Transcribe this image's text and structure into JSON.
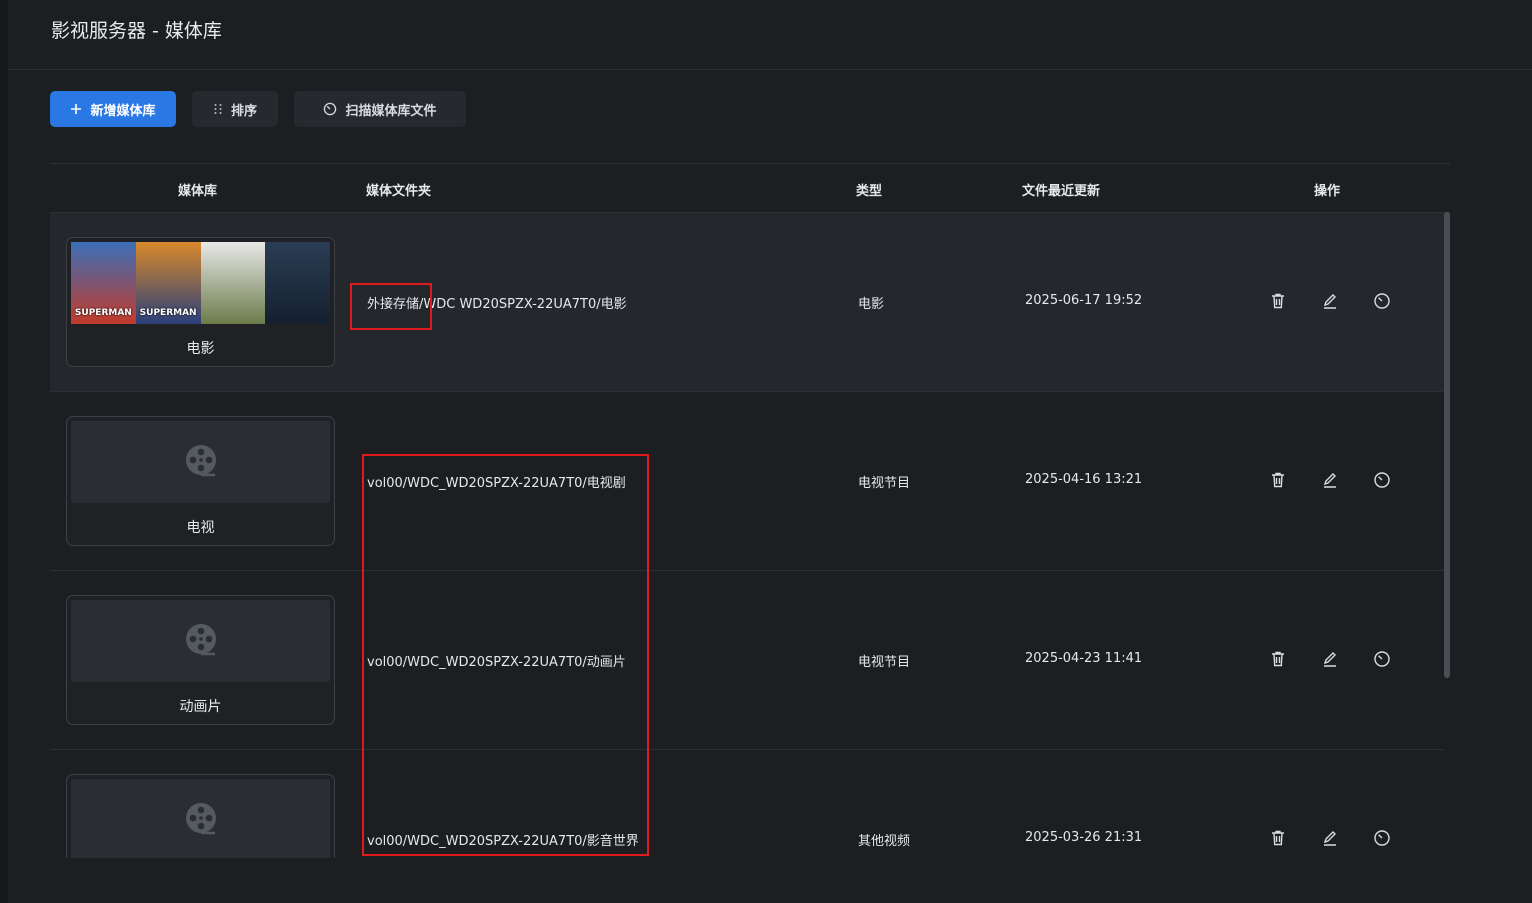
{
  "window": {
    "title": "影视服务器 - 媒体库"
  },
  "toolbar": {
    "add_label": "新增媒体库",
    "sort_label": "排序",
    "scan_label": "扫描媒体库文件",
    "accent_color": "#2a78e4"
  },
  "table": {
    "columns": [
      "媒体库",
      "媒体文件夹",
      "类型",
      "文件最近更新",
      "操作"
    ],
    "rows": [
      {
        "library": "电影",
        "folder": "外接存储/WDC WD20SPZX-22UA7T0/电影",
        "type": "电影",
        "updated": "2025-06-17 19:52",
        "thumbnail": "posters"
      },
      {
        "library": "电视",
        "folder": "vol00/WDC_WD20SPZX-22UA7T0/电视剧",
        "type": "电视节目",
        "updated": "2025-04-16 13:21",
        "thumbnail": "film-reel-icon"
      },
      {
        "library": "动画片",
        "folder": "vol00/WDC_WD20SPZX-22UA7T0/动画片",
        "type": "电视节目",
        "updated": "2025-04-23 11:41",
        "thumbnail": "film-reel-icon"
      },
      {
        "library": "",
        "folder": "vol00/WDC_WD20SPZX-22UA7T0/影音世界",
        "type": "其他视频",
        "updated": "2025-03-26 21:31",
        "thumbnail": "film-reel-icon"
      }
    ],
    "row_actions": [
      "trash-icon",
      "edit-icon",
      "scan-icon"
    ]
  },
  "posters": [
    {
      "text": "SUPERMAN",
      "color_top": "#3a6fb8",
      "color_bottom": "#c23b2a"
    },
    {
      "text": "SUPERMAN",
      "color_top": "#d98a2b",
      "color_bottom": "#2b3f7a"
    },
    {
      "text": "",
      "color_top": "#e8e8e8",
      "color_bottom": "#6b7b4a"
    },
    {
      "text": "",
      "color_top": "#2b3d55",
      "color_bottom": "#14202e"
    }
  ]
}
